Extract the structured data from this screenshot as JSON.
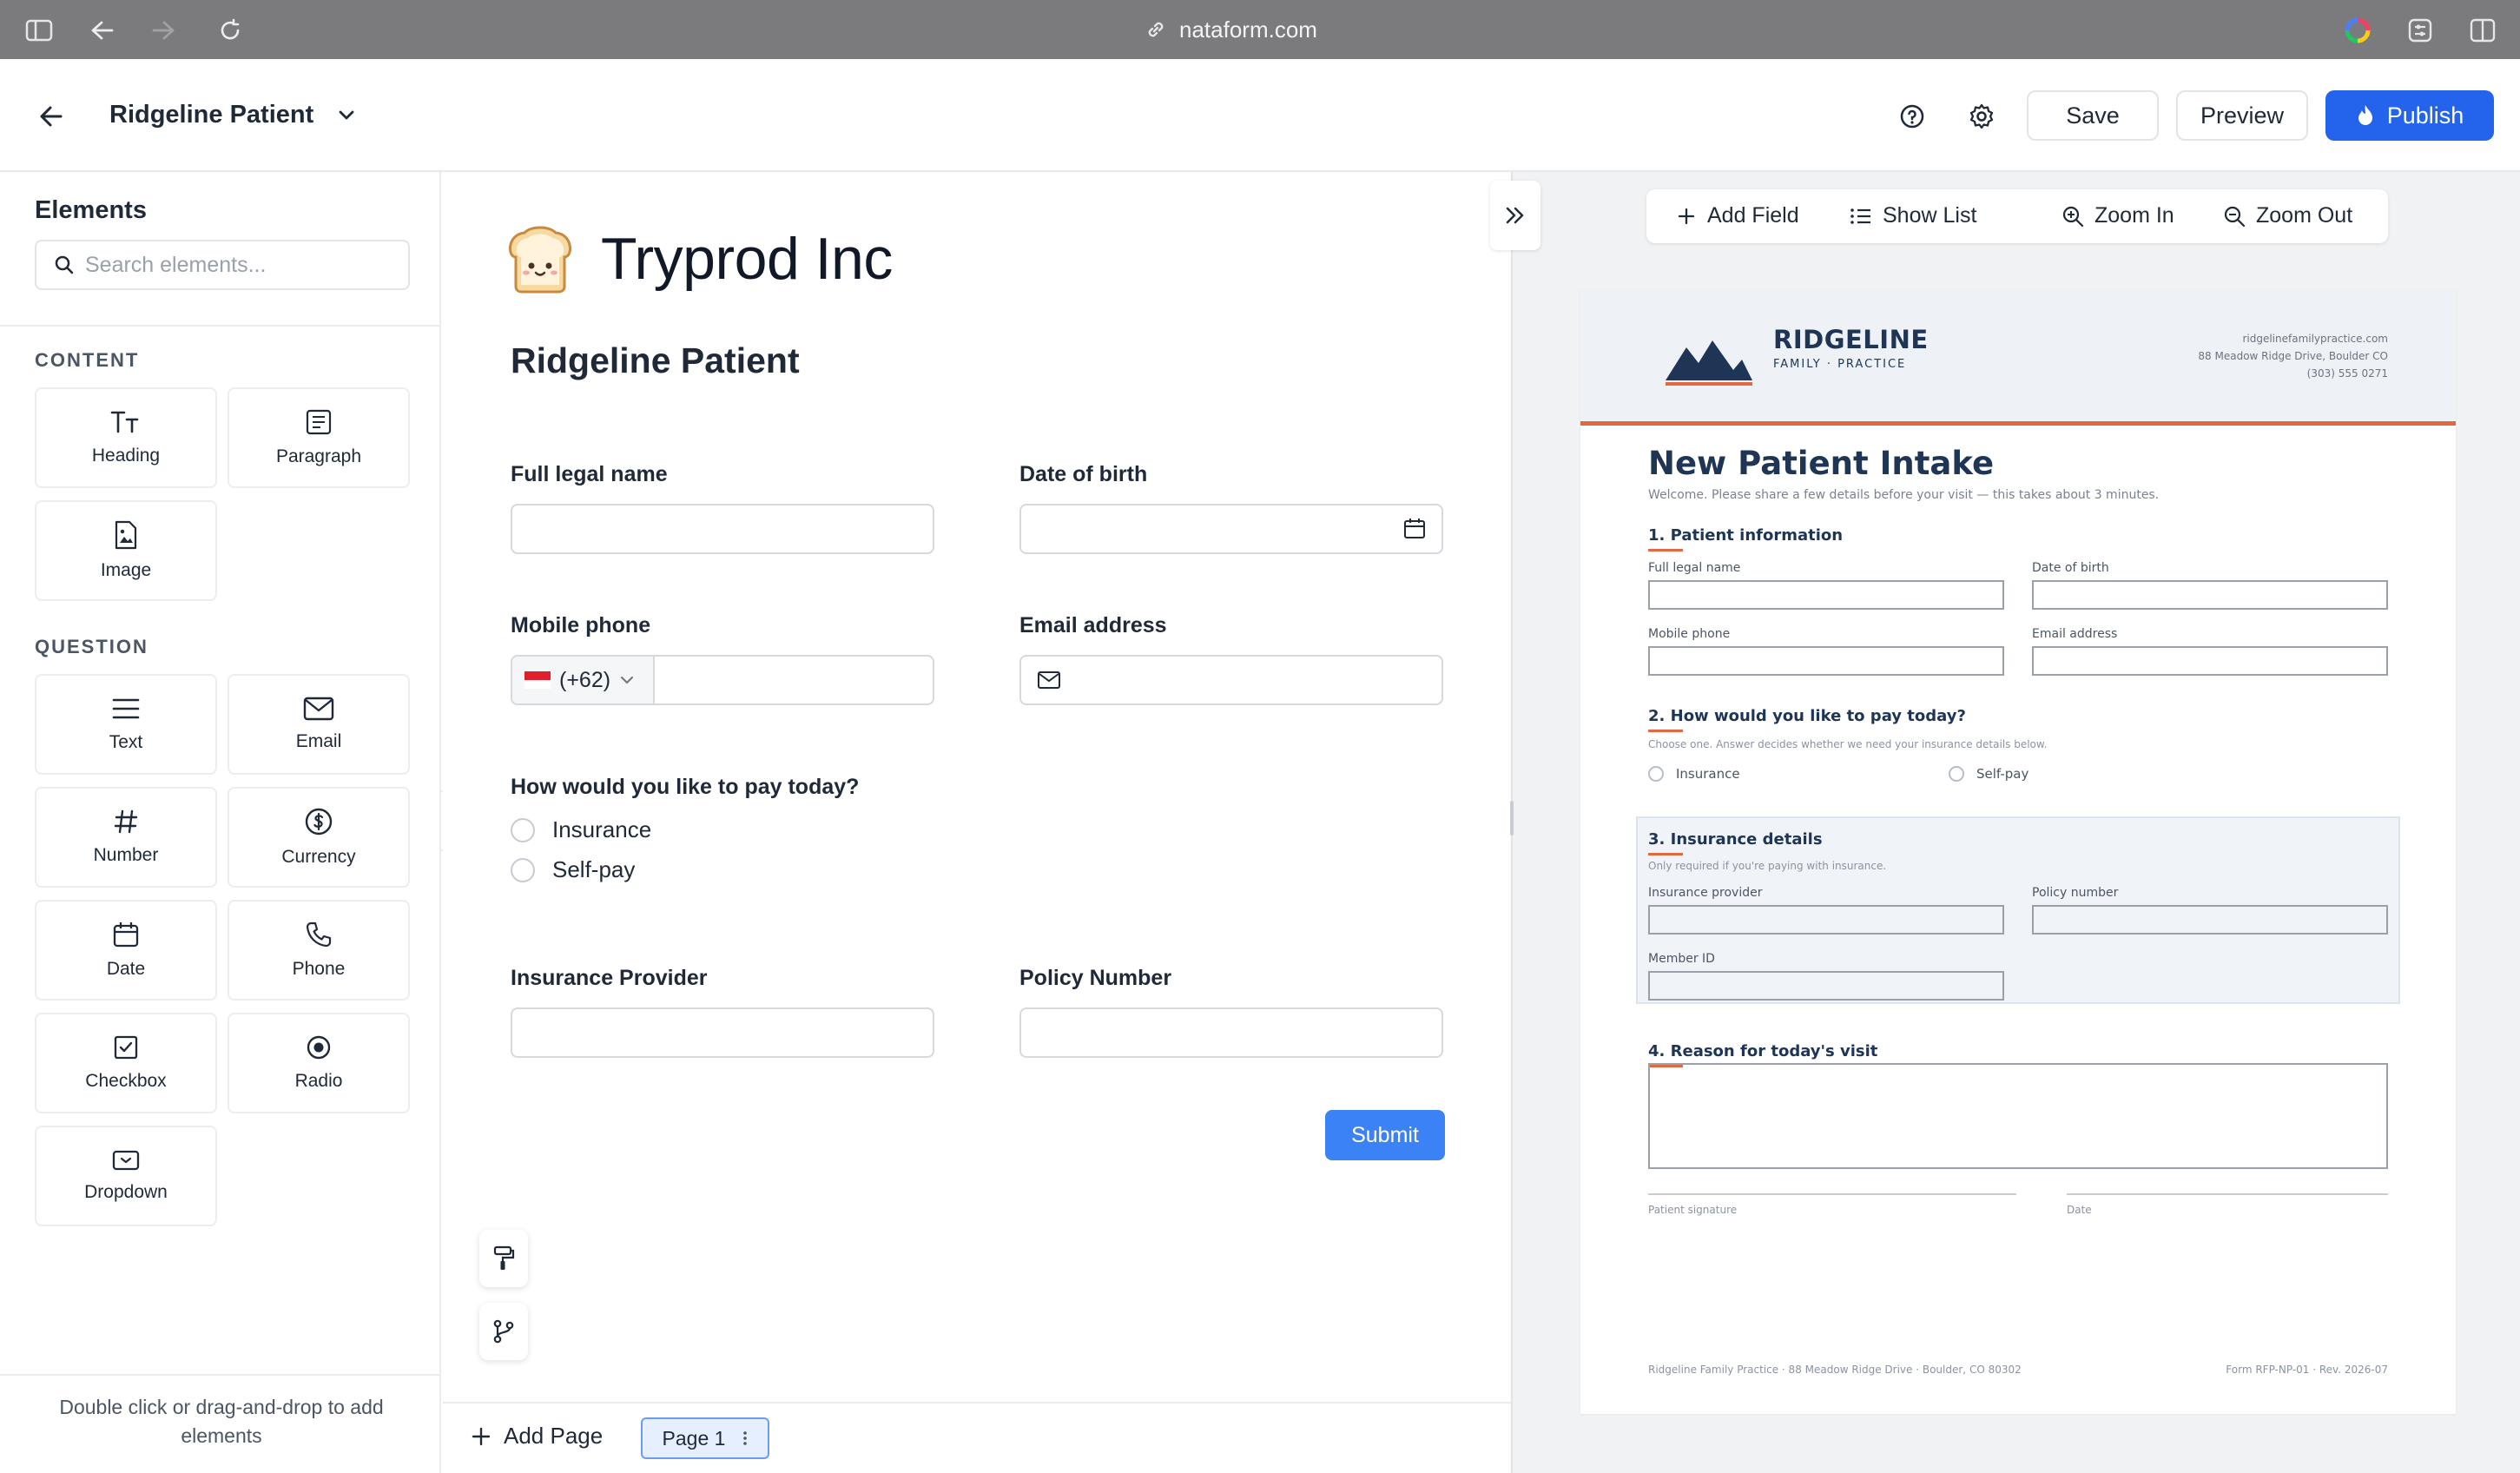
{
  "browser": {
    "url": "nataform.com"
  },
  "header": {
    "form_name": "Ridgeline Patient",
    "save_label": "Save",
    "preview_label": "Preview",
    "publish_label": "Publish"
  },
  "sidebar": {
    "title": "Elements",
    "search_placeholder": "Search elements...",
    "content_section": "CONTENT",
    "content_items": [
      {
        "label": "Heading",
        "icon": "heading-icon"
      },
      {
        "label": "Paragraph",
        "icon": "paragraph-icon"
      },
      {
        "label": "Image",
        "icon": "image-icon"
      }
    ],
    "question_section": "QUESTION",
    "question_items": [
      {
        "label": "Text",
        "icon": "text-icon"
      },
      {
        "label": "Email",
        "icon": "email-icon"
      },
      {
        "label": "Number",
        "icon": "number-icon"
      },
      {
        "label": "Currency",
        "icon": "currency-icon"
      },
      {
        "label": "Date",
        "icon": "date-icon"
      },
      {
        "label": "Phone",
        "icon": "phone-icon"
      },
      {
        "label": "Checkbox",
        "icon": "checkbox-icon"
      },
      {
        "label": "Radio",
        "icon": "radio-icon"
      },
      {
        "label": "Dropdown",
        "icon": "dropdown-icon"
      }
    ],
    "footer_hint": "Double click or drag-and-drop to add elements"
  },
  "canvas": {
    "brand_emoji": "🍞",
    "brand_name": "Tryprod Inc",
    "form_title": "Ridgeline Patient",
    "fields": {
      "full_name": "Full legal name",
      "dob": "Date of birth",
      "mobile": "Mobile phone",
      "country_code": "(+62)",
      "email": "Email address",
      "pay_question": "How would you like to pay today?",
      "pay_options": [
        "Insurance",
        "Self-pay"
      ],
      "insurance_provider": "Insurance Provider",
      "policy_number": "Policy Number"
    },
    "submit_label": "Submit"
  },
  "pagebar": {
    "add_page_label": "Add Page",
    "current_page": "Page 1"
  },
  "preview_toolbar": {
    "add_field": "Add Field",
    "show_list": "Show List",
    "zoom_in": "Zoom In",
    "zoom_out": "Zoom Out"
  },
  "document": {
    "logo_name": "RIDGELINE",
    "logo_sub": "FAMILY · PRACTICE",
    "contact": [
      "ridgelinefamilypractice.com",
      "88 Meadow Ridge Drive, Boulder CO",
      "(303) 555 0271"
    ],
    "title": "New Patient Intake",
    "welcome": "Welcome. Please share a few details before your visit — this takes about 3 minutes.",
    "sec1": "1. Patient information",
    "full_name": "Full legal name",
    "dob": "Date of birth",
    "mobile": "Mobile phone",
    "email": "Email address",
    "sec2": "2. How would you like to pay today?",
    "sec2_note": "Choose one. Answer decides whether we need your insurance details below.",
    "pay_options": [
      "Insurance",
      "Self-pay"
    ],
    "sec3": "3. Insurance details",
    "sec3_note": "Only required if you're paying with insurance.",
    "insurance_provider": "Insurance provider",
    "policy_number": "Policy number",
    "member_id": "Member ID",
    "sec4": "4. Reason for today's visit",
    "patient_signature": "Patient signature",
    "date": "Date",
    "footer_left": "Ridgeline Family Practice · 88 Meadow Ridge Drive · Boulder, CO 80302",
    "footer_right": "Form RFP-NP-01 · Rev. 2026-07"
  },
  "colors": {
    "primary": "#2463eb",
    "submit": "#3b82f6",
    "doc_navy": "#1e3556",
    "doc_accent": "#e2693f"
  }
}
